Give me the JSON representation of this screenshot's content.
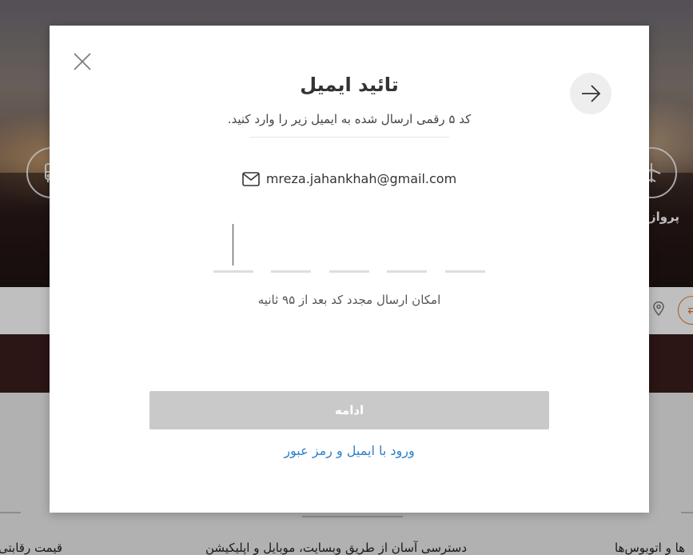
{
  "background": {
    "services": {
      "left_icon": "bus-icon",
      "right_icon": "airplane-icon",
      "right_label": "پرواز"
    },
    "search": {
      "location_icon": "location-pin-icon",
      "swap_icon": "swap-arrows-icon",
      "swap_glyph": "⇄"
    },
    "features": [
      "قیمت رقابتی",
      "دسترسی آسان از طریق وبسایت، موبایل و اپلیکیشن",
      "ها و اتوبوس‌ها"
    ]
  },
  "modal": {
    "close_icon": "close-icon",
    "back_icon": "arrow-right-icon",
    "title": "تائید ایمیل",
    "subtitle": "کد ۵ رقمی ارسال شده به ایمیل زیر را وارد کنید.",
    "email_icon": "mail-icon",
    "email": "mreza.jahankhah@gmail.com",
    "code_values": [
      "",
      "",
      "",
      "",
      ""
    ],
    "resend_text": "امکان ارسال مجدد کد بعد از ۹۵ ثانیه",
    "continue_label": "ادامه",
    "alt_login_label": "ورود با ایمیل و رمز عبور"
  },
  "colors": {
    "link": "#2f80c8",
    "button_disabled": "#c9c9c9",
    "accent": "#e07b2a"
  }
}
